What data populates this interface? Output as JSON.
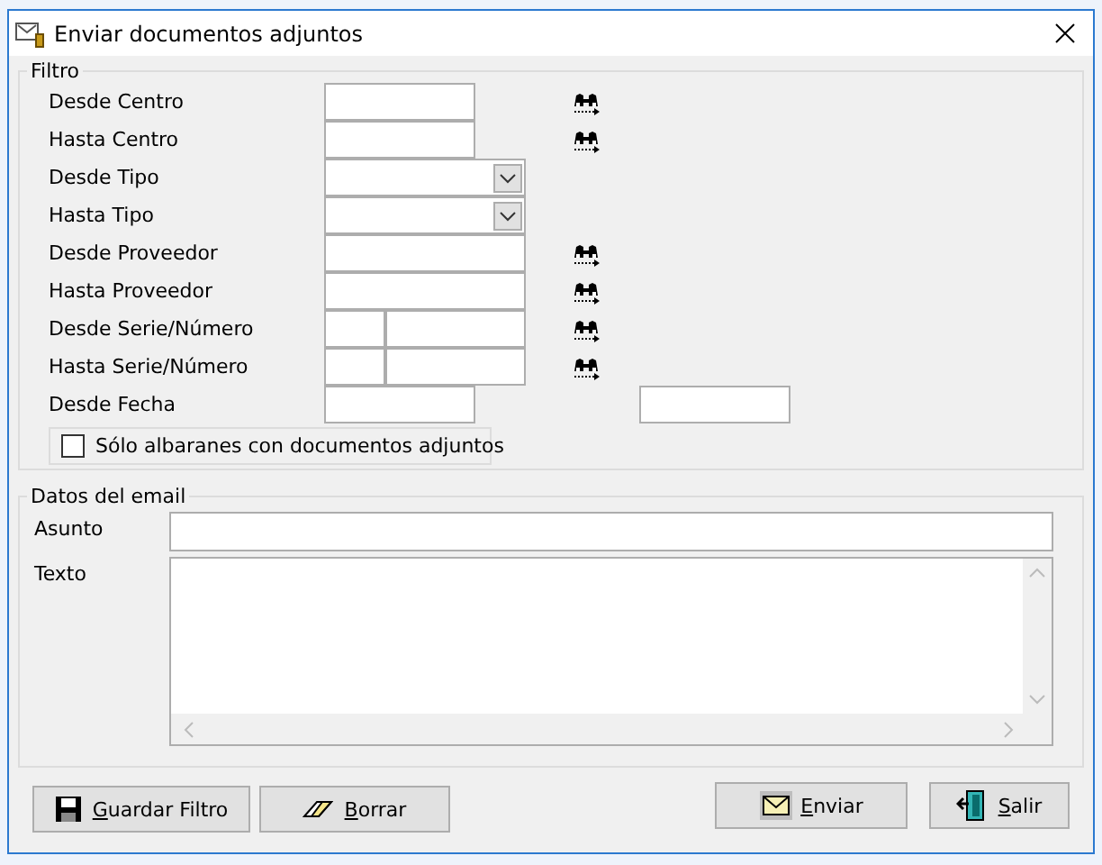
{
  "window": {
    "title": "Enviar documentos adjuntos"
  },
  "filter": {
    "legend": "Filtro",
    "rows": [
      {
        "label": "Desde Centro",
        "kind": "short",
        "lookup": true
      },
      {
        "label": "Hasta Centro",
        "kind": "short",
        "lookup": true
      },
      {
        "label": "Desde Tipo",
        "kind": "combo",
        "lookup": false
      },
      {
        "label": "Hasta Tipo",
        "kind": "combo",
        "lookup": false
      },
      {
        "label": "Desde Proveedor",
        "kind": "long",
        "lookup": true
      },
      {
        "label": "Hasta Proveedor",
        "kind": "long",
        "lookup": true
      },
      {
        "label": "Desde Serie/Número",
        "kind": "split",
        "lookup": true
      },
      {
        "label": "Hasta Serie/Número",
        "kind": "split",
        "lookup": true
      },
      {
        "label": "Desde Fecha",
        "kind": "date_pair",
        "lookup": false
      }
    ],
    "checkbox": {
      "label": "Sólo albaranes con documentos adjuntos",
      "checked": false
    }
  },
  "email": {
    "legend": "Datos del email",
    "subject_label": "Asunto",
    "text_label": "Texto"
  },
  "buttons": [
    {
      "label": "Guardar Filtro",
      "kind": "save"
    },
    {
      "label": "Borrar",
      "kind": "erase"
    },
    {
      "label": "Enviar",
      "kind": "send"
    },
    {
      "label": "Salir",
      "kind": "exit"
    }
  ]
}
